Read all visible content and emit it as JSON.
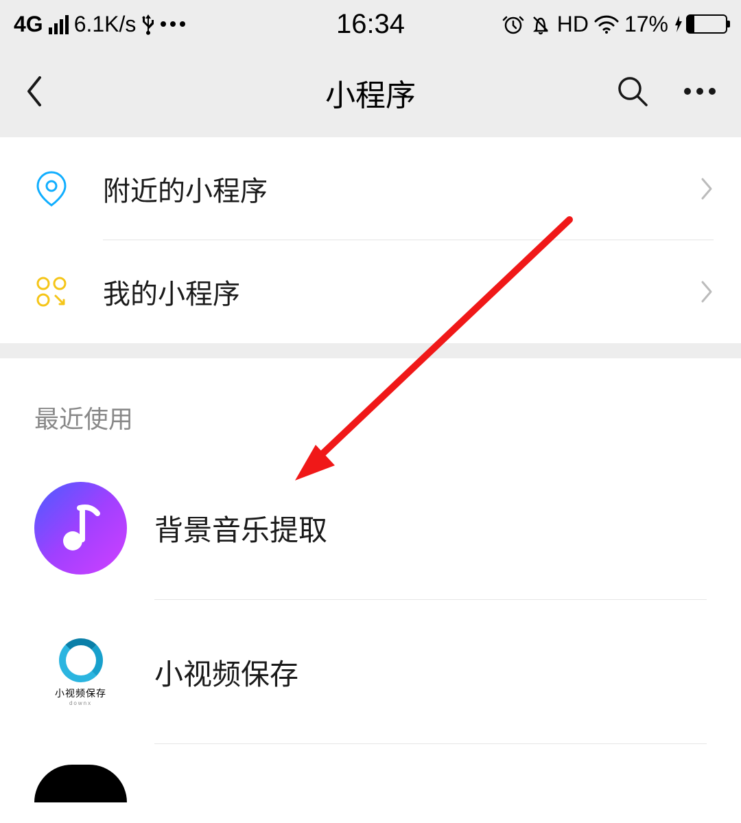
{
  "statusBar": {
    "network": "4G",
    "speed": "6.1K/s",
    "time": "16:34",
    "hd": "HD",
    "batteryPercent": "17%"
  },
  "navBar": {
    "title": "小程序"
  },
  "menu": {
    "nearby": "附近的小程序",
    "mine": "我的小程序"
  },
  "recent": {
    "header": "最近使用",
    "items": [
      {
        "label": "背景音乐提取"
      },
      {
        "label": "小视频保存",
        "iconCaption": "小视频保存",
        "iconSub": "downx"
      }
    ]
  }
}
